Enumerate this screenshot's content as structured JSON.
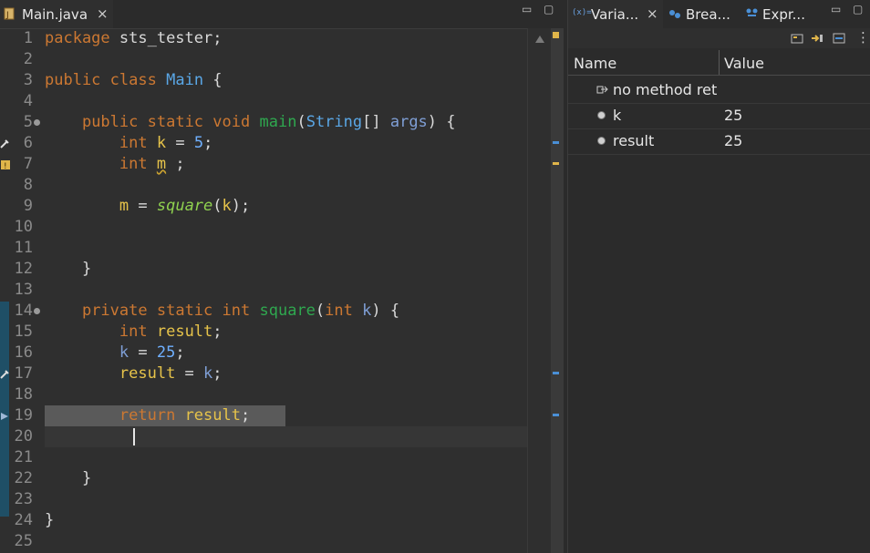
{
  "editor": {
    "tab_label": "Main.java",
    "close_glyph": "×",
    "minimize_glyph": "▭",
    "maximize_glyph": "▢"
  },
  "code": {
    "lines": [
      {
        "n": "1",
        "text": "package sts_tester;"
      },
      {
        "n": "2",
        "text": ""
      },
      {
        "n": "3",
        "text": "public class Main {"
      },
      {
        "n": "4",
        "text": ""
      },
      {
        "n": "5",
        "text": "    public static void main(String[] args) {"
      },
      {
        "n": "6",
        "text": "        int k = 5;"
      },
      {
        "n": "7",
        "text": "        int m ;"
      },
      {
        "n": "8",
        "text": ""
      },
      {
        "n": "9",
        "text": "        m = square(k);"
      },
      {
        "n": "10",
        "text": ""
      },
      {
        "n": "11",
        "text": ""
      },
      {
        "n": "12",
        "text": "    }"
      },
      {
        "n": "13",
        "text": ""
      },
      {
        "n": "14",
        "text": "    private static int square(int k) {"
      },
      {
        "n": "15",
        "text": "        int result;"
      },
      {
        "n": "16",
        "text": "        k = 25;"
      },
      {
        "n": "17",
        "text": "        result = k;"
      },
      {
        "n": "18",
        "text": ""
      },
      {
        "n": "19",
        "text": "        return result;"
      },
      {
        "n": "20",
        "text": ""
      },
      {
        "n": "21",
        "text": ""
      },
      {
        "n": "22",
        "text": "    }"
      },
      {
        "n": "23",
        "text": ""
      },
      {
        "n": "24",
        "text": "}"
      },
      {
        "n": "25",
        "text": ""
      }
    ]
  },
  "variables_view": {
    "tabs": [
      {
        "label": "Varia...",
        "icon": "variables-icon",
        "close": "×"
      },
      {
        "label": "Brea...",
        "icon": "breakpoints-icon"
      },
      {
        "label": "Expr...",
        "icon": "expressions-icon"
      }
    ],
    "columns": {
      "name": "Name",
      "value": "Value"
    },
    "rows": [
      {
        "name": "no method ret",
        "value": "",
        "icon": "method-return-icon"
      },
      {
        "name": "k",
        "value": "25",
        "icon": "local-variable-icon"
      },
      {
        "name": "result",
        "value": "25",
        "icon": "local-variable-icon"
      }
    ]
  },
  "colors": {
    "background": "#2f2f2f",
    "keyword": "#cc7832",
    "type": "#5aa7e6",
    "method": "#2fa84f",
    "highlight": "#5a5a5a"
  }
}
